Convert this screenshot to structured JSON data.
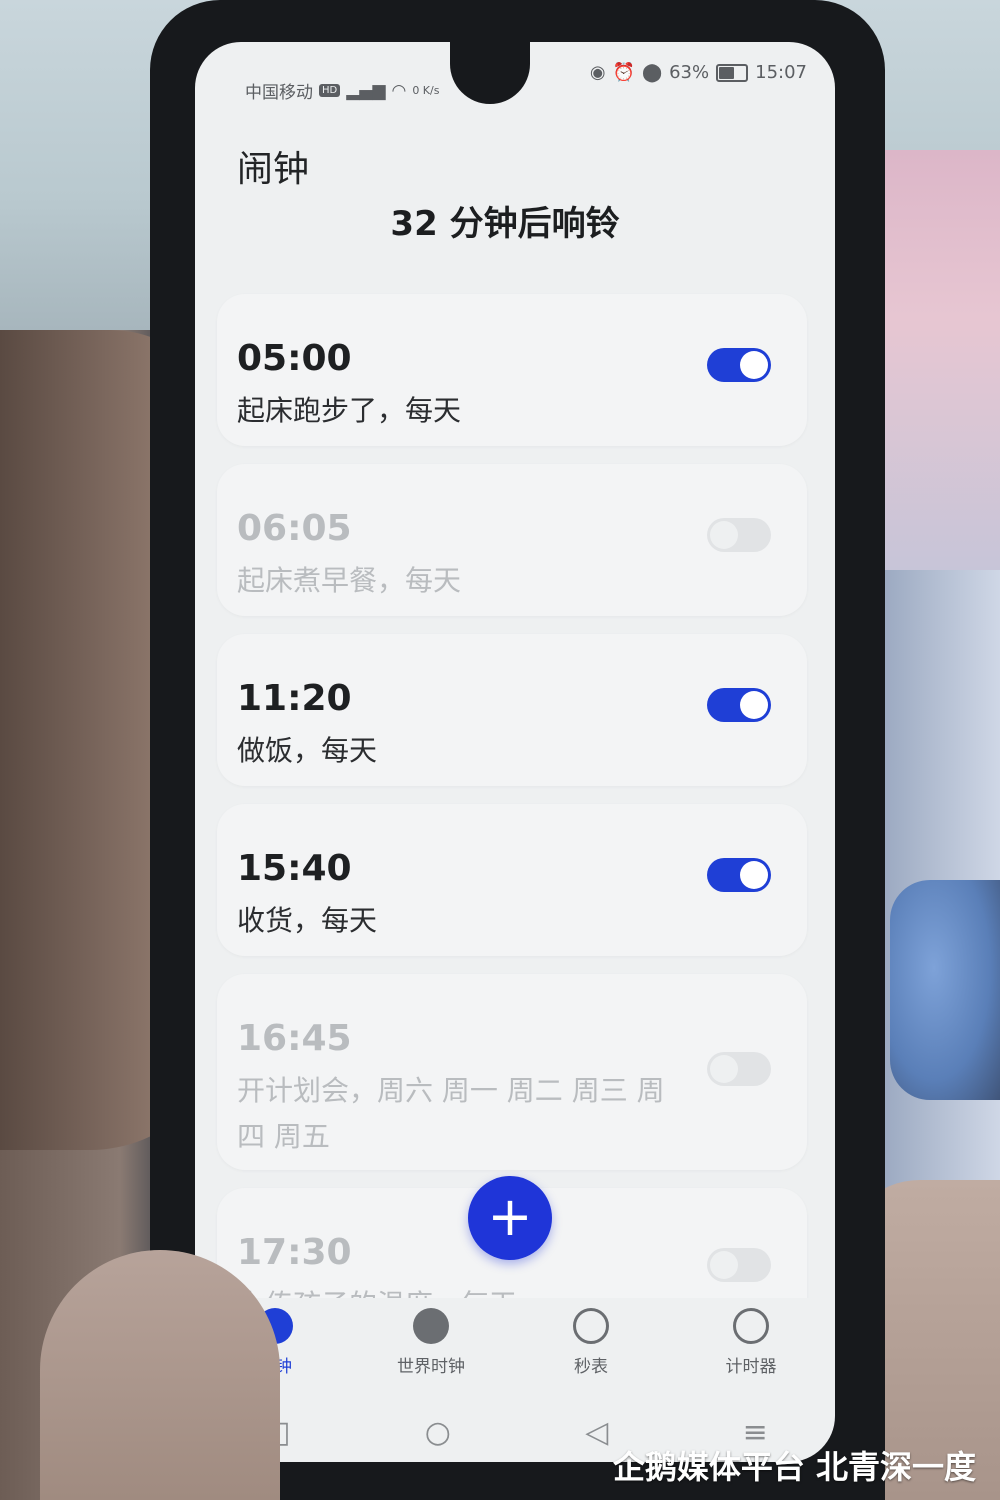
{
  "status_bar": {
    "carrier": "中国移动",
    "hd": "HD",
    "speed": "0 K/s",
    "battery": "63%",
    "battery_level": 0.63,
    "time": "15:07"
  },
  "header": {
    "title": "闹钟",
    "next_alarm": "32 分钟后响铃"
  },
  "alarms": [
    {
      "time": "05:00",
      "label": "起床跑步了，每天",
      "enabled": true
    },
    {
      "time": "06:05",
      "label": "起床煮早餐，每天",
      "enabled": false
    },
    {
      "time": "11:20",
      "label": "做饭，每天",
      "enabled": true
    },
    {
      "time": "15:40",
      "label": "收货，每天",
      "enabled": true
    },
    {
      "time": "16:45",
      "label": "开计划会，周六 周一 周二 周三 周四 周五",
      "enabled": false
    },
    {
      "time": "17:30",
      "label": "上传孩子的温度，每天",
      "enabled": false
    }
  ],
  "fab": {
    "icon": "plus-icon",
    "symbol": "+"
  },
  "bottom_nav": [
    {
      "label": "闹钟",
      "icon": "alarm-clock-icon",
      "active": true
    },
    {
      "label": "世界时钟",
      "icon": "globe-icon",
      "active": false
    },
    {
      "label": "秒表",
      "icon": "stopwatch-icon",
      "active": false
    },
    {
      "label": "计时器",
      "icon": "timer-icon",
      "active": false
    }
  ],
  "system_nav": {
    "recents": "□",
    "home": "○",
    "back": "◁",
    "menu": "≡"
  },
  "watermark": "企鹅媒体平台 北青深一度",
  "colors": {
    "accent": "#1f3fd6",
    "toggle_off": "#e1e3e5",
    "text_primary": "#1e2022",
    "text_disabled": "#b9bcbf"
  }
}
